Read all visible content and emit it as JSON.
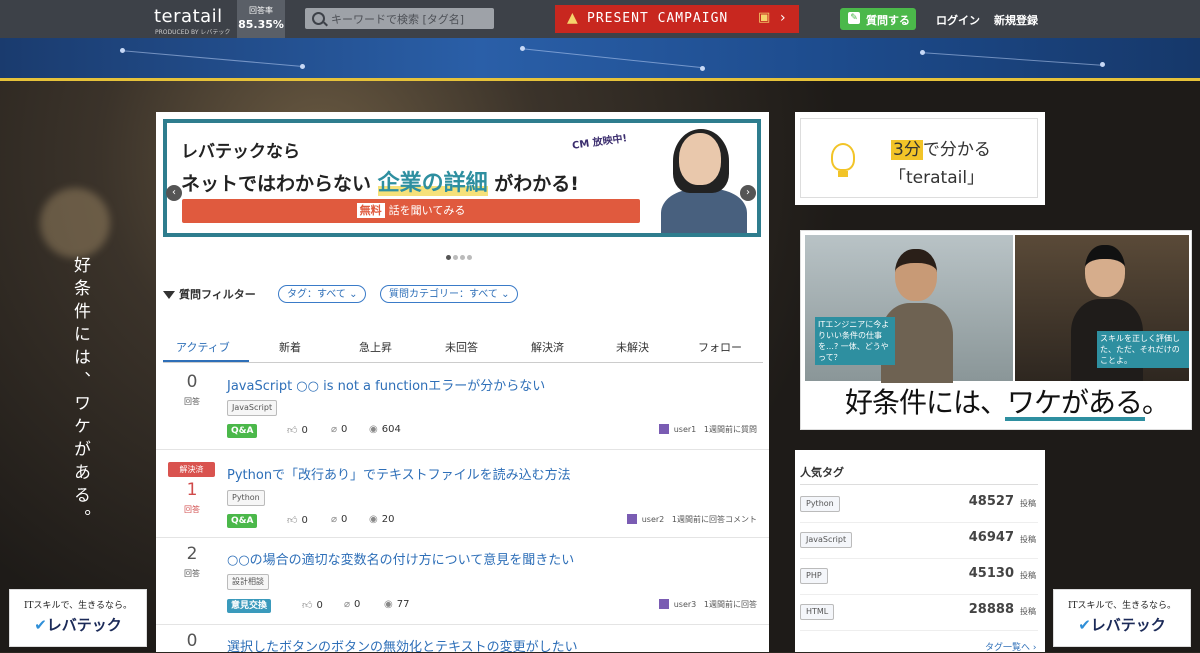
{
  "header": {
    "logo": "teratail",
    "logo_sub": "PRODUCED BY レバテック",
    "rate_label": "回答率",
    "rate_value": "85.35%",
    "search_placeholder": "キーワードで検索 [タグ名]",
    "campaign": "PRESENT CAMPAIGN",
    "ask_button": "質問する",
    "login": "ログイン",
    "signup": "新規登録"
  },
  "side": {
    "vertical_text": "好条件には、ワケがある。",
    "ad_line1": "ITスキルで、生きるなら。",
    "ad_logo": "レバテック"
  },
  "carousel": {
    "line1": "レバテックなら",
    "line2_pre": "ネットではわからない",
    "line2_hl": "企業の詳細",
    "line2_post": "がわかる!",
    "cm": "CM 放映中!",
    "btn_free": "無料",
    "btn_text": "話を聞いてみる",
    "prev": "‹",
    "next": "›"
  },
  "filter": {
    "label": "質問フィルター",
    "tag": "タグ：すべて",
    "category": "質問カテゴリー：すべて"
  },
  "tabs": [
    "アクティブ",
    "新着",
    "急上昇",
    "未回答",
    "解決済",
    "未解決",
    "フォロー"
  ],
  "questions": [
    {
      "count": "0",
      "count_label": "回答",
      "solved_badge": "",
      "title": "JavaScript ○○ is not a functionエラーが分からない",
      "tag": "JavaScript",
      "type": "Q&A",
      "likes": "0",
      "clips": "0",
      "views": "604",
      "user": "user1",
      "time": "1週間前に質問"
    },
    {
      "count": "1",
      "count_label": "回答",
      "solved_badge": "解決済",
      "title": "Pythonで「改行あり」でテキストファイルを読み込む方法",
      "tag": "Python",
      "type": "Q&A",
      "likes": "0",
      "clips": "0",
      "views": "20",
      "user": "user2",
      "time": "1週間前に回答コメント"
    },
    {
      "count": "2",
      "count_label": "回答",
      "solved_badge": "",
      "title": "○○の場合の適切な変数名の付け方について意見を聞きたい",
      "tag": "設計相談",
      "type": "意見交換",
      "likes": "0",
      "clips": "0",
      "views": "77",
      "user": "user3",
      "time": "1週間前に回答"
    },
    {
      "count": "0",
      "title": "選択したボタンのボタンの無効化とテキストの変更がしたい"
    }
  ],
  "right": {
    "promo_num": "3分",
    "promo_l1": "で分かる",
    "promo_l2": "「teratail」",
    "ad_bubble1": "ITエンジニアに今よりいい条件の仕事を…? 一体、どうやって？",
    "ad_bubble2": "スキルを正しく評価した、ただ、それだけのことよ。",
    "ad_copy": "好条件には、ワケがある。",
    "popular_heading": "人気タグ",
    "popular": [
      {
        "tag": "Python",
        "count": "48527",
        "unit": "投稿"
      },
      {
        "tag": "JavaScript",
        "count": "46947",
        "unit": "投稿"
      },
      {
        "tag": "PHP",
        "count": "45130",
        "unit": "投稿"
      },
      {
        "tag": "HTML",
        "count": "28888",
        "unit": "投稿"
      }
    ],
    "more": "タグ一覧へ ›"
  }
}
